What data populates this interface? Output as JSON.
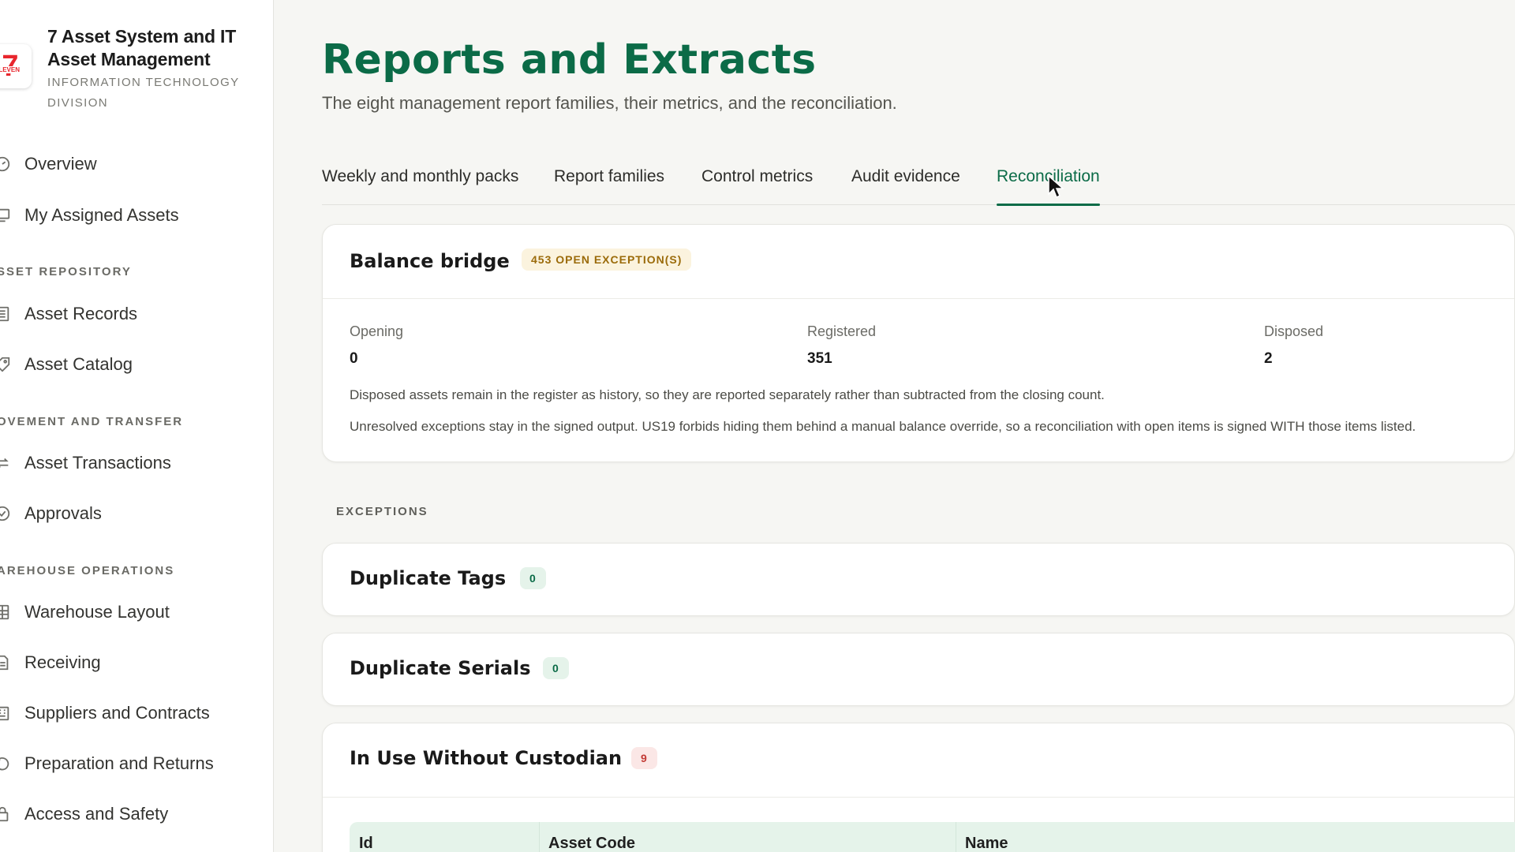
{
  "brand": {
    "logo_text": "7",
    "logo_sub": "ELEVEN",
    "title": "7 Asset System and IT Asset Management",
    "subtitle": "INFORMATION TECHNOLOGY DIVISION"
  },
  "sidebar": {
    "items": [
      {
        "label": "Overview",
        "icon": "gauge-icon"
      },
      {
        "label": "My Assigned Assets",
        "icon": "monitor-icon"
      },
      {
        "section": "SSET REPOSITORY"
      },
      {
        "label": "Asset Records",
        "icon": "list-icon"
      },
      {
        "label": "Asset Catalog",
        "icon": "tag-icon"
      },
      {
        "section": "OVEMENT AND TRANSFER"
      },
      {
        "label": "Asset Transactions",
        "icon": "arrows-icon"
      },
      {
        "label": "Approvals",
        "icon": "check-circle-icon"
      },
      {
        "section": "AREHOUSE OPERATIONS"
      },
      {
        "label": "Warehouse Layout",
        "icon": "layout-icon"
      },
      {
        "label": "Receiving",
        "icon": "document-icon"
      },
      {
        "label": "Suppliers and Contracts",
        "icon": "building-icon"
      },
      {
        "label": "Preparation and Returns",
        "icon": "return-icon"
      },
      {
        "label": "Access and Safety",
        "icon": "lock-icon"
      }
    ]
  },
  "page": {
    "title": "Reports and Extracts",
    "subtitle": "The eight management report families, their metrics, and the reconciliation."
  },
  "tabs": [
    {
      "label": "Weekly and monthly packs",
      "active": false
    },
    {
      "label": "Report families",
      "active": false
    },
    {
      "label": "Control metrics",
      "active": false
    },
    {
      "label": "Audit evidence",
      "active": false
    },
    {
      "label": "Reconciliation",
      "active": true
    }
  ],
  "balance_bridge": {
    "title": "Balance bridge",
    "badge": "453 OPEN EXCEPTION(S)",
    "metrics": [
      {
        "label": "Opening",
        "value": "0"
      },
      {
        "label": "Registered",
        "value": "351"
      },
      {
        "label": "Disposed",
        "value": "2"
      }
    ],
    "notes": [
      "Disposed assets remain in the register as history, so they are reported separately rather than subtracted from the closing count.",
      "Unresolved exceptions stay in the signed output. US19 forbids hiding them behind a manual balance override, so a reconciliation with open items is signed WITH those items listed."
    ]
  },
  "exceptions": {
    "label": "EXCEPTIONS",
    "groups": [
      {
        "title": "Duplicate Tags",
        "count": "0"
      },
      {
        "title": "Duplicate Serials",
        "count": "0"
      },
      {
        "title": "In Use Without Custodian",
        "count": "9"
      }
    ],
    "table_headers": [
      "Id",
      "Asset Code",
      "Name"
    ]
  },
  "colors": {
    "accent": "#0b6b47",
    "warn": "#9b6b0a",
    "danger": "#c23a35",
    "logo_red": "#e8262d"
  }
}
